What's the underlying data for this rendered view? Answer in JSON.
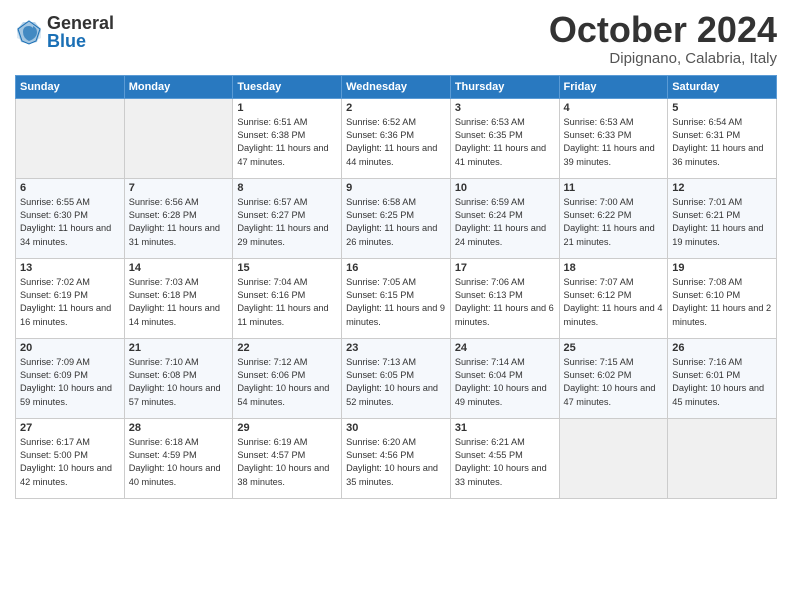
{
  "header": {
    "logo_general": "General",
    "logo_blue": "Blue",
    "month_title": "October 2024",
    "location": "Dipignano, Calabria, Italy"
  },
  "columns": [
    "Sunday",
    "Monday",
    "Tuesday",
    "Wednesday",
    "Thursday",
    "Friday",
    "Saturday"
  ],
  "weeks": [
    [
      {
        "day": "",
        "info": ""
      },
      {
        "day": "",
        "info": ""
      },
      {
        "day": "1",
        "info": "Sunrise: 6:51 AM\nSunset: 6:38 PM\nDaylight: 11 hours and 47 minutes."
      },
      {
        "day": "2",
        "info": "Sunrise: 6:52 AM\nSunset: 6:36 PM\nDaylight: 11 hours and 44 minutes."
      },
      {
        "day": "3",
        "info": "Sunrise: 6:53 AM\nSunset: 6:35 PM\nDaylight: 11 hours and 41 minutes."
      },
      {
        "day": "4",
        "info": "Sunrise: 6:53 AM\nSunset: 6:33 PM\nDaylight: 11 hours and 39 minutes."
      },
      {
        "day": "5",
        "info": "Sunrise: 6:54 AM\nSunset: 6:31 PM\nDaylight: 11 hours and 36 minutes."
      }
    ],
    [
      {
        "day": "6",
        "info": "Sunrise: 6:55 AM\nSunset: 6:30 PM\nDaylight: 11 hours and 34 minutes."
      },
      {
        "day": "7",
        "info": "Sunrise: 6:56 AM\nSunset: 6:28 PM\nDaylight: 11 hours and 31 minutes."
      },
      {
        "day": "8",
        "info": "Sunrise: 6:57 AM\nSunset: 6:27 PM\nDaylight: 11 hours and 29 minutes."
      },
      {
        "day": "9",
        "info": "Sunrise: 6:58 AM\nSunset: 6:25 PM\nDaylight: 11 hours and 26 minutes."
      },
      {
        "day": "10",
        "info": "Sunrise: 6:59 AM\nSunset: 6:24 PM\nDaylight: 11 hours and 24 minutes."
      },
      {
        "day": "11",
        "info": "Sunrise: 7:00 AM\nSunset: 6:22 PM\nDaylight: 11 hours and 21 minutes."
      },
      {
        "day": "12",
        "info": "Sunrise: 7:01 AM\nSunset: 6:21 PM\nDaylight: 11 hours and 19 minutes."
      }
    ],
    [
      {
        "day": "13",
        "info": "Sunrise: 7:02 AM\nSunset: 6:19 PM\nDaylight: 11 hours and 16 minutes."
      },
      {
        "day": "14",
        "info": "Sunrise: 7:03 AM\nSunset: 6:18 PM\nDaylight: 11 hours and 14 minutes."
      },
      {
        "day": "15",
        "info": "Sunrise: 7:04 AM\nSunset: 6:16 PM\nDaylight: 11 hours and 11 minutes."
      },
      {
        "day": "16",
        "info": "Sunrise: 7:05 AM\nSunset: 6:15 PM\nDaylight: 11 hours and 9 minutes."
      },
      {
        "day": "17",
        "info": "Sunrise: 7:06 AM\nSunset: 6:13 PM\nDaylight: 11 hours and 6 minutes."
      },
      {
        "day": "18",
        "info": "Sunrise: 7:07 AM\nSunset: 6:12 PM\nDaylight: 11 hours and 4 minutes."
      },
      {
        "day": "19",
        "info": "Sunrise: 7:08 AM\nSunset: 6:10 PM\nDaylight: 11 hours and 2 minutes."
      }
    ],
    [
      {
        "day": "20",
        "info": "Sunrise: 7:09 AM\nSunset: 6:09 PM\nDaylight: 10 hours and 59 minutes."
      },
      {
        "day": "21",
        "info": "Sunrise: 7:10 AM\nSunset: 6:08 PM\nDaylight: 10 hours and 57 minutes."
      },
      {
        "day": "22",
        "info": "Sunrise: 7:12 AM\nSunset: 6:06 PM\nDaylight: 10 hours and 54 minutes."
      },
      {
        "day": "23",
        "info": "Sunrise: 7:13 AM\nSunset: 6:05 PM\nDaylight: 10 hours and 52 minutes."
      },
      {
        "day": "24",
        "info": "Sunrise: 7:14 AM\nSunset: 6:04 PM\nDaylight: 10 hours and 49 minutes."
      },
      {
        "day": "25",
        "info": "Sunrise: 7:15 AM\nSunset: 6:02 PM\nDaylight: 10 hours and 47 minutes."
      },
      {
        "day": "26",
        "info": "Sunrise: 7:16 AM\nSunset: 6:01 PM\nDaylight: 10 hours and 45 minutes."
      }
    ],
    [
      {
        "day": "27",
        "info": "Sunrise: 6:17 AM\nSunset: 5:00 PM\nDaylight: 10 hours and 42 minutes."
      },
      {
        "day": "28",
        "info": "Sunrise: 6:18 AM\nSunset: 4:59 PM\nDaylight: 10 hours and 40 minutes."
      },
      {
        "day": "29",
        "info": "Sunrise: 6:19 AM\nSunset: 4:57 PM\nDaylight: 10 hours and 38 minutes."
      },
      {
        "day": "30",
        "info": "Sunrise: 6:20 AM\nSunset: 4:56 PM\nDaylight: 10 hours and 35 minutes."
      },
      {
        "day": "31",
        "info": "Sunrise: 6:21 AM\nSunset: 4:55 PM\nDaylight: 10 hours and 33 minutes."
      },
      {
        "day": "",
        "info": ""
      },
      {
        "day": "",
        "info": ""
      }
    ]
  ]
}
